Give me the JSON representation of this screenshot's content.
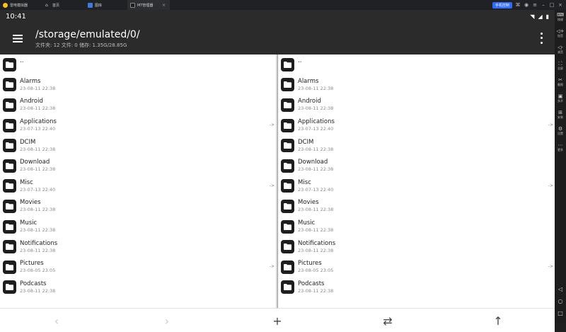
{
  "emulator": {
    "app_title": "雷电模拟器",
    "tabs": [
      {
        "label": "首页"
      },
      {
        "label": "图库"
      },
      {
        "label": "MT管理器",
        "active": true
      }
    ],
    "phone_control_label": "手机控制",
    "sidebar": [
      {
        "icon": "keyboard-icon",
        "glyph": "⌨",
        "label": "按键"
      },
      {
        "icon": "volume-up-icon",
        "glyph": "◁+",
        "label": "加音"
      },
      {
        "icon": "volume-down-icon",
        "glyph": "◁-",
        "label": "减音"
      },
      {
        "icon": "fullscreen-icon",
        "glyph": "⛶",
        "label": "全屏"
      },
      {
        "icon": "scissors-icon",
        "glyph": "✂",
        "label": "截图"
      },
      {
        "icon": "multi-window-icon",
        "glyph": "▣",
        "label": "多开"
      },
      {
        "icon": "install-icon",
        "glyph": "⊞",
        "label": "安装"
      },
      {
        "icon": "settings-icon",
        "glyph": "⚙",
        "label": "设置"
      },
      {
        "icon": "more-icon",
        "glyph": "⋯",
        "label": "更多"
      }
    ]
  },
  "statusbar": {
    "time": "10:41"
  },
  "appbar": {
    "path": "/storage/emulated/0/",
    "subtitle": "文件夹: 12  文件: 0  储存: 1.35G/28.85G"
  },
  "parent_label": "..",
  "left_pane": {
    "items": [
      {
        "name": "Alarms",
        "date": "23-08-11 22:38",
        "arrow": false
      },
      {
        "name": "Android",
        "date": "23-08-11 22:38",
        "arrow": false
      },
      {
        "name": "Applications",
        "date": "23-07-13 22:40",
        "arrow": true
      },
      {
        "name": "DCIM",
        "date": "23-08-11 22:38",
        "arrow": false
      },
      {
        "name": "Download",
        "date": "23-08-11 22:38",
        "arrow": false
      },
      {
        "name": "Misc",
        "date": "23-07-13 22:40",
        "arrow": true
      },
      {
        "name": "Movies",
        "date": "23-08-11 22:38",
        "arrow": false
      },
      {
        "name": "Music",
        "date": "23-08-11 22:38",
        "arrow": false
      },
      {
        "name": "Notifications",
        "date": "23-08-11 22:38",
        "arrow": false
      },
      {
        "name": "Pictures",
        "date": "23-08-05 23:05",
        "arrow": true
      },
      {
        "name": "Podcasts",
        "date": "23-08-11 22:38",
        "arrow": false
      }
    ]
  },
  "right_pane": {
    "items": [
      {
        "name": "Alarms",
        "date": "23-08-11 22:38",
        "arrow": false
      },
      {
        "name": "Android",
        "date": "23-08-11 22:38",
        "arrow": false
      },
      {
        "name": "Applications",
        "date": "23-07-13 22:40",
        "arrow": true
      },
      {
        "name": "DCIM",
        "date": "23-08-11 22:38",
        "arrow": false
      },
      {
        "name": "Download",
        "date": "23-08-11 22:38",
        "arrow": false
      },
      {
        "name": "Misc",
        "date": "23-07-13 22:40",
        "arrow": true
      },
      {
        "name": "Movies",
        "date": "23-08-11 22:38",
        "arrow": false
      },
      {
        "name": "Music",
        "date": "23-08-11 22:38",
        "arrow": false
      },
      {
        "name": "Notifications",
        "date": "23-08-11 22:38",
        "arrow": false
      },
      {
        "name": "Pictures",
        "date": "23-08-05 23:05",
        "arrow": true
      },
      {
        "name": "Podcasts",
        "date": "23-08-11 22:38",
        "arrow": false
      }
    ]
  },
  "row_arrow_glyph": "->",
  "bottombar": {
    "back": "‹",
    "forward": "›",
    "add": "+",
    "swap": "⇄",
    "up": "↑"
  }
}
